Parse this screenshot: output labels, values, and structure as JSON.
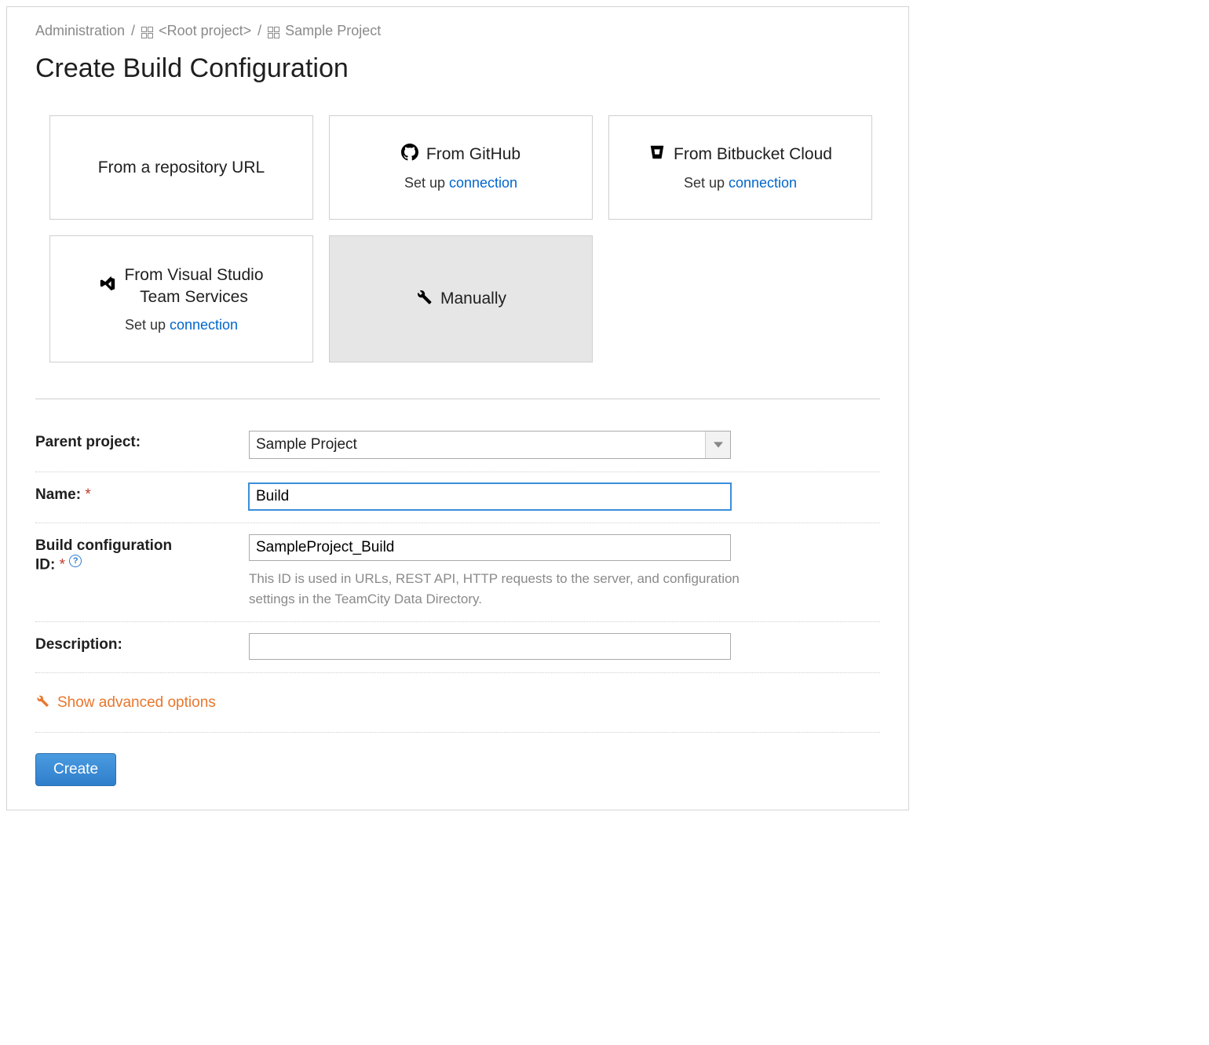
{
  "breadcrumb": {
    "admin": "Administration",
    "root": "<Root project>",
    "project": "Sample Project"
  },
  "title": "Create Build Configuration",
  "cards": {
    "repo_url": {
      "label": "From a repository URL"
    },
    "github": {
      "label": "From GitHub",
      "setup": "Set up ",
      "link": "connection"
    },
    "bitbucket": {
      "label": "From Bitbucket Cloud",
      "setup": "Set up ",
      "link": "connection"
    },
    "vsts": {
      "label_l1": "From Visual Studio",
      "label_l2": "Team Services",
      "setup": "Set up ",
      "link": "connection"
    },
    "manually": {
      "label": "Manually"
    }
  },
  "form": {
    "parent_label": "Parent project:",
    "parent_value": "Sample Project",
    "name_label": "Name: ",
    "name_value": "Build",
    "id_label_l1": "Build configuration",
    "id_label_l2": "ID: ",
    "id_value": "SampleProject_Build",
    "id_help": "This ID is used in URLs, REST API, HTTP requests to the server, and configuration settings in the TeamCity Data Directory.",
    "desc_label": "Description:",
    "desc_value": ""
  },
  "advanced_label": "Show advanced options",
  "create_button": "Create"
}
